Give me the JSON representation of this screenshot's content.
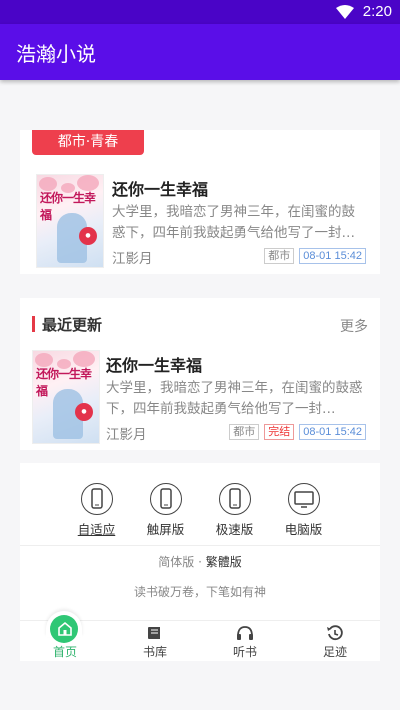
{
  "status": {
    "time": "2:20",
    "wifi_icon": "wifi-icon"
  },
  "app": {
    "title": "浩瀚小说"
  },
  "featured": {
    "tag": "都市·青春",
    "book": {
      "title": "还你一生幸福",
      "cover_text": "还你一生幸福",
      "description": "大学里，我暗恋了男神三年，在闺蜜的鼓惑下，四年前我鼓起勇气给他写了一封…",
      "author": "江影月",
      "badges": [
        "都市"
      ],
      "time": "08-01 15:42"
    }
  },
  "recent": {
    "heading": "最近更新",
    "more": "更多",
    "book": {
      "title": "还你一生幸福",
      "cover_text": "还你一生幸福",
      "description": "大学里，我暗恋了男神三年，在闺蜜的鼓惑下，四年前我鼓起勇气给他写了一封…",
      "author": "江影月",
      "badges": [
        "都市",
        "完结"
      ],
      "time": "08-01 15:42"
    }
  },
  "footer": {
    "versions": [
      {
        "label": "自适应",
        "icon": "phone-icon",
        "active": true
      },
      {
        "label": "触屏版",
        "icon": "phone-icon",
        "active": false
      },
      {
        "label": "极速版",
        "icon": "phone-icon",
        "active": false
      },
      {
        "label": "电脑版",
        "icon": "monitor-icon",
        "active": false
      }
    ],
    "lang_simplified": "简体版",
    "lang_sep": "·",
    "lang_traditional": "繁體版",
    "motto": "读书破万卷，下笔如有神"
  },
  "tabs": [
    {
      "label": "首页",
      "icon": "home-icon",
      "active": true
    },
    {
      "label": "书库",
      "icon": "book-icon",
      "active": false
    },
    {
      "label": "听书",
      "icon": "headphones-icon",
      "active": false
    },
    {
      "label": "足迹",
      "icon": "history-icon",
      "active": false
    }
  ],
  "colors": {
    "appbar": "#5a0ee8",
    "statusbar": "#4a04c7",
    "accent_red": "#ee3f4d",
    "accent_green": "#2fc775",
    "time_blue": "#5b8ed8"
  }
}
